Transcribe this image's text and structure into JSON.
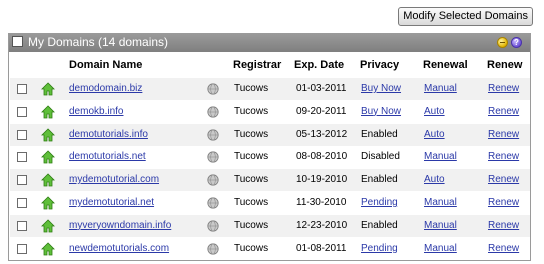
{
  "toolbar": {
    "modify_label": "Modify Selected Domains"
  },
  "panel": {
    "title": "My Domains (14 domains)"
  },
  "columns": {
    "domain": "Domain Name",
    "registrar": "Registrar",
    "exp_date": "Exp. Date",
    "privacy": "Privacy",
    "renewal": "Renewal",
    "renew": "Renew"
  },
  "icons": {
    "home": "home-icon",
    "globe": "globe-icon",
    "minimize": "minimize-icon",
    "help": "help-icon"
  },
  "colors": {
    "header_bg": "#8c8c8c",
    "link": "#2b39a8",
    "row_alt": "#f1f1f1"
  },
  "rows": [
    {
      "domain": "demodomain.biz",
      "registrar": "Tucows",
      "exp": "01-03-2011",
      "privacy": "Buy Now",
      "privacy_link": true,
      "renewal": "Manual",
      "renew": "Renew"
    },
    {
      "domain": "demokb.info",
      "registrar": "Tucows",
      "exp": "09-20-2011",
      "privacy": "Buy Now",
      "privacy_link": true,
      "renewal": "Auto",
      "renew": "Renew"
    },
    {
      "domain": "demotutorials.info",
      "registrar": "Tucows",
      "exp": "05-13-2012",
      "privacy": "Enabled",
      "privacy_link": false,
      "renewal": "Auto",
      "renew": "Renew"
    },
    {
      "domain": "demotutorials.net",
      "registrar": "Tucows",
      "exp": "08-08-2010",
      "privacy": "Disabled",
      "privacy_link": false,
      "renewal": "Manual",
      "renew": "Renew"
    },
    {
      "domain": "mydemotutorial.com",
      "registrar": "Tucows",
      "exp": "10-19-2010",
      "privacy": "Enabled",
      "privacy_link": false,
      "renewal": "Auto",
      "renew": "Renew"
    },
    {
      "domain": "mydemotutorial.net",
      "registrar": "Tucows",
      "exp": "11-30-2010",
      "privacy": "Pending",
      "privacy_link": true,
      "renewal": "Manual",
      "renew": "Renew"
    },
    {
      "domain": "myveryowndomain.info",
      "registrar": "Tucows",
      "exp": "12-23-2010",
      "privacy": "Enabled",
      "privacy_link": false,
      "renewal": "Manual",
      "renew": "Renew"
    },
    {
      "domain": "newdemotutorials.com",
      "registrar": "Tucows",
      "exp": "01-08-2011",
      "privacy": "Pending",
      "privacy_link": true,
      "renewal": "Manual",
      "renew": "Renew"
    }
  ]
}
